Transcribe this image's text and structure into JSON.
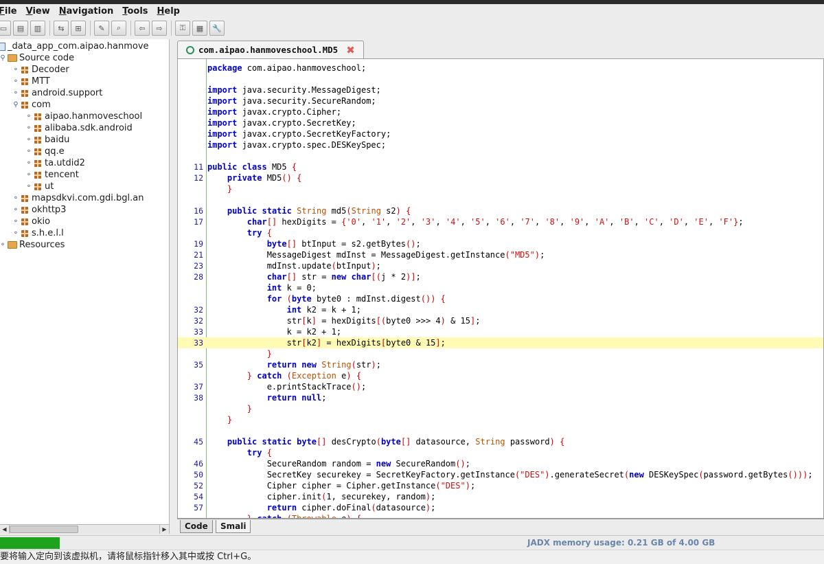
{
  "menu": [
    "File",
    "View",
    "Navigation",
    "Tools",
    "Help"
  ],
  "menu_mnemonics": [
    "F",
    "V",
    "N",
    "T",
    "H"
  ],
  "tree": {
    "root": "_data_app_com.aipao.hanmove",
    "source_code": "Source code",
    "packages": [
      "Decoder",
      "MTT",
      "android.support",
      "com"
    ],
    "com_children": [
      "aipao.hanmoveschool",
      "alibaba.sdk.android",
      "baidu",
      "qq.e",
      "ta.utdid2",
      "tencent",
      "ut"
    ],
    "after_com": [
      "mapsdkvi.com.gdi.bgl.an",
      "okhttp3",
      "okio",
      "s.h.e.l.l"
    ],
    "resources": "Resources"
  },
  "tab": {
    "title": "com.aipao.hanmoveschool.MD5"
  },
  "code_lines": [
    {
      "n": "",
      "t": "package com.aipao.hanmoveschool;"
    },
    {
      "n": "",
      "t": ""
    },
    {
      "n": "",
      "t": "import java.security.MessageDigest;"
    },
    {
      "n": "",
      "t": "import java.security.SecureRandom;"
    },
    {
      "n": "",
      "t": "import javax.crypto.Cipher;"
    },
    {
      "n": "",
      "t": "import javax.crypto.SecretKey;"
    },
    {
      "n": "",
      "t": "import javax.crypto.SecretKeyFactory;"
    },
    {
      "n": "",
      "t": "import javax.crypto.spec.DESKeySpec;"
    },
    {
      "n": "",
      "t": ""
    },
    {
      "n": "11",
      "t": "public class MD5 {"
    },
    {
      "n": "12",
      "t": "    private MD5() {"
    },
    {
      "n": "",
      "t": "    }"
    },
    {
      "n": "",
      "t": ""
    },
    {
      "n": "16",
      "t": "    public static String md5(String s2) {"
    },
    {
      "n": "17",
      "t": "        char[] hexDigits = {'0', '1', '2', '3', '4', '5', '6', '7', '8', '9', 'A', 'B', 'C', 'D', 'E', 'F'};"
    },
    {
      "n": "",
      "t": "        try {"
    },
    {
      "n": "19",
      "t": "            byte[] btInput = s2.getBytes();"
    },
    {
      "n": "21",
      "t": "            MessageDigest mdInst = MessageDigest.getInstance(\"MD5\");"
    },
    {
      "n": "23",
      "t": "            mdInst.update(btInput);"
    },
    {
      "n": "28",
      "t": "            char[] str = new char[(j * 2)];"
    },
    {
      "n": "",
      "t": "            int k = 0;"
    },
    {
      "n": "",
      "t": "            for (byte byte0 : mdInst.digest()) {"
    },
    {
      "n": "32",
      "t": "                int k2 = k + 1;"
    },
    {
      "n": "32",
      "t": "                str[k] = hexDigits[(byte0 >>> 4) & 15];"
    },
    {
      "n": "33",
      "t": "                k = k2 + 1;"
    },
    {
      "n": "33",
      "t": "                str[k2] = hexDigits[byte0 & 15];",
      "hl": true
    },
    {
      "n": "",
      "t": "            }"
    },
    {
      "n": "35",
      "t": "            return new String(str);"
    },
    {
      "n": "",
      "t": "        } catch (Exception e) {"
    },
    {
      "n": "37",
      "t": "            e.printStackTrace();"
    },
    {
      "n": "38",
      "t": "            return null;"
    },
    {
      "n": "",
      "t": "        }"
    },
    {
      "n": "",
      "t": "    }"
    },
    {
      "n": "",
      "t": ""
    },
    {
      "n": "45",
      "t": "    public static byte[] desCrypto(byte[] datasource, String password) {"
    },
    {
      "n": "",
      "t": "        try {"
    },
    {
      "n": "46",
      "t": "            SecureRandom random = new SecureRandom();"
    },
    {
      "n": "50",
      "t": "            SecretKey securekey = SecretKeyFactory.getInstance(\"DES\").generateSecret(new DESKeySpec(password.getBytes()));"
    },
    {
      "n": "52",
      "t": "            Cipher cipher = Cipher.getInstance(\"DES\");"
    },
    {
      "n": "54",
      "t": "            cipher.init(1, securekey, random);"
    },
    {
      "n": "57",
      "t": "            return cipher.doFinal(datasource);"
    },
    {
      "n": "",
      "t": "        } catch (Throwable e) {"
    }
  ],
  "bottom_tabs": [
    "Code",
    "Smali"
  ],
  "status": {
    "memory": "JADX memory usage: 0.21 GB of 4.00 GB"
  },
  "notice": "要将输入定向到该虚拟机，请将鼠标指针移入其中或按 Ctrl+G。",
  "colors": {
    "keyword": "#0000c8",
    "type": "#c05000",
    "string": "#d01010",
    "highlight": "#fffbb4",
    "progress": "#1fa31f"
  }
}
